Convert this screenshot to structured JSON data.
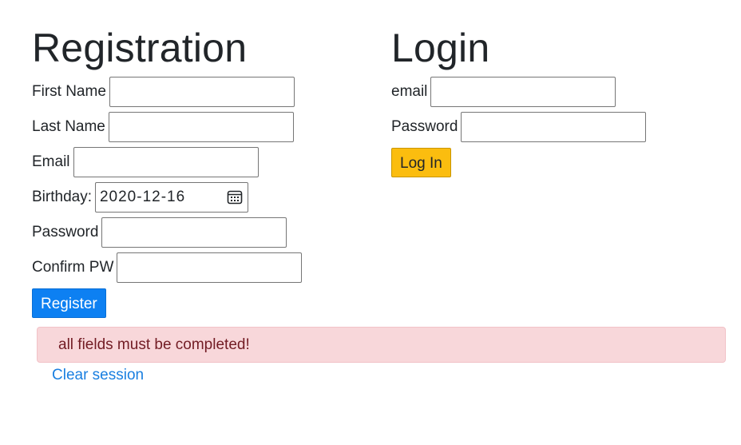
{
  "registration": {
    "title": "Registration",
    "fields": {
      "first_name": {
        "label": "First Name",
        "value": ""
      },
      "last_name": {
        "label": "Last Name",
        "value": ""
      },
      "email": {
        "label": "Email",
        "value": ""
      },
      "birthday": {
        "label": "Birthday:",
        "value": "2020-12-16"
      },
      "password": {
        "label": "Password",
        "value": ""
      },
      "confirm_pw": {
        "label": "Confirm PW",
        "value": ""
      }
    },
    "submit_label": "Register",
    "submit_color": "#0d80f2"
  },
  "login": {
    "title": "Login",
    "fields": {
      "email": {
        "label": "email",
        "value": ""
      },
      "password": {
        "label": "Password",
        "value": ""
      }
    },
    "submit_label": "Log In",
    "submit_color": "#fbbd0f"
  },
  "alert": {
    "message": "all fields must be completed!",
    "color": "#f8d7da"
  },
  "links": {
    "clear_session": "Clear session"
  },
  "icons": {
    "birthday_picker": "calendar-icon"
  }
}
